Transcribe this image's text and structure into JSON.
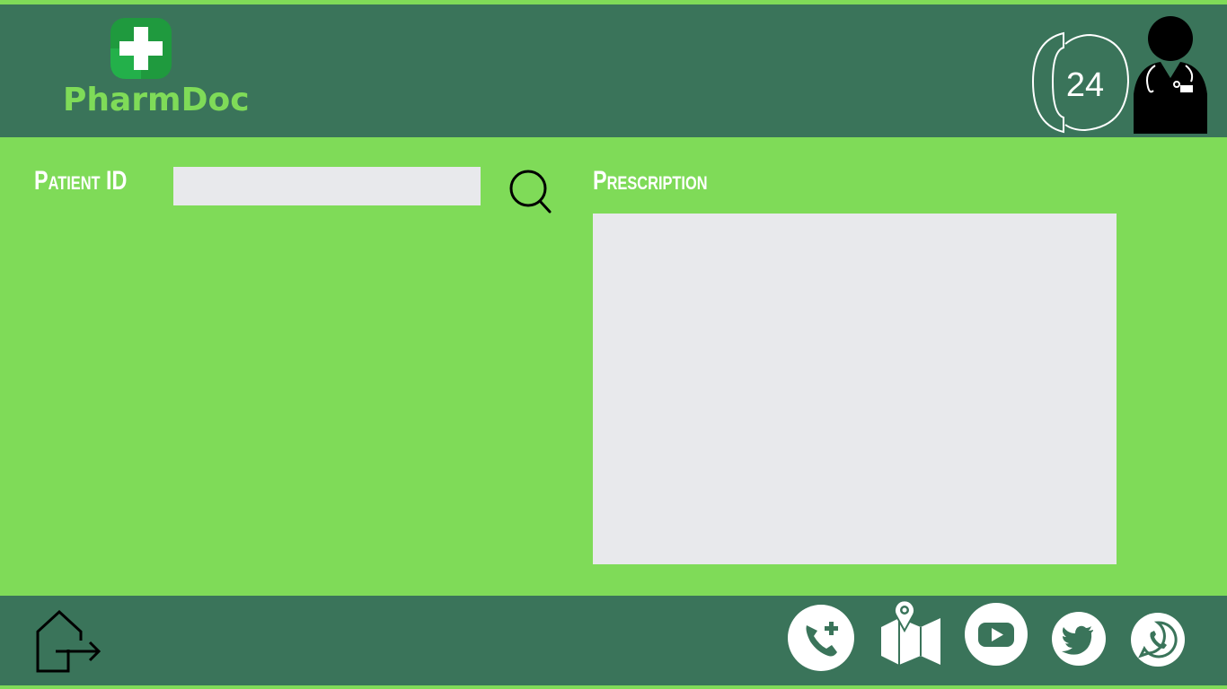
{
  "app": {
    "name": "PharmDoc"
  },
  "header": {
    "support_hours": "24"
  },
  "form": {
    "patient_id_label": "Patient ID",
    "patient_id_value": "",
    "patient_id_placeholder": "",
    "prescription_label": "Prescription",
    "prescription_value": ""
  },
  "icons": {
    "logo": "medical-cross-icon",
    "support": "phone-24-hours-icon",
    "avatar": "doctor-icon",
    "search": "search-icon",
    "logout": "home-logout-icon",
    "footer": [
      "emergency-call-icon",
      "map-location-icon",
      "youtube-icon",
      "twitter-icon",
      "whatsapp-icon"
    ]
  },
  "colors": {
    "background": "#7fdb58",
    "bar": "#3a745a",
    "input": "#e8e9ec",
    "logo_green": "#1f9a3e",
    "text": "#ffffff"
  }
}
